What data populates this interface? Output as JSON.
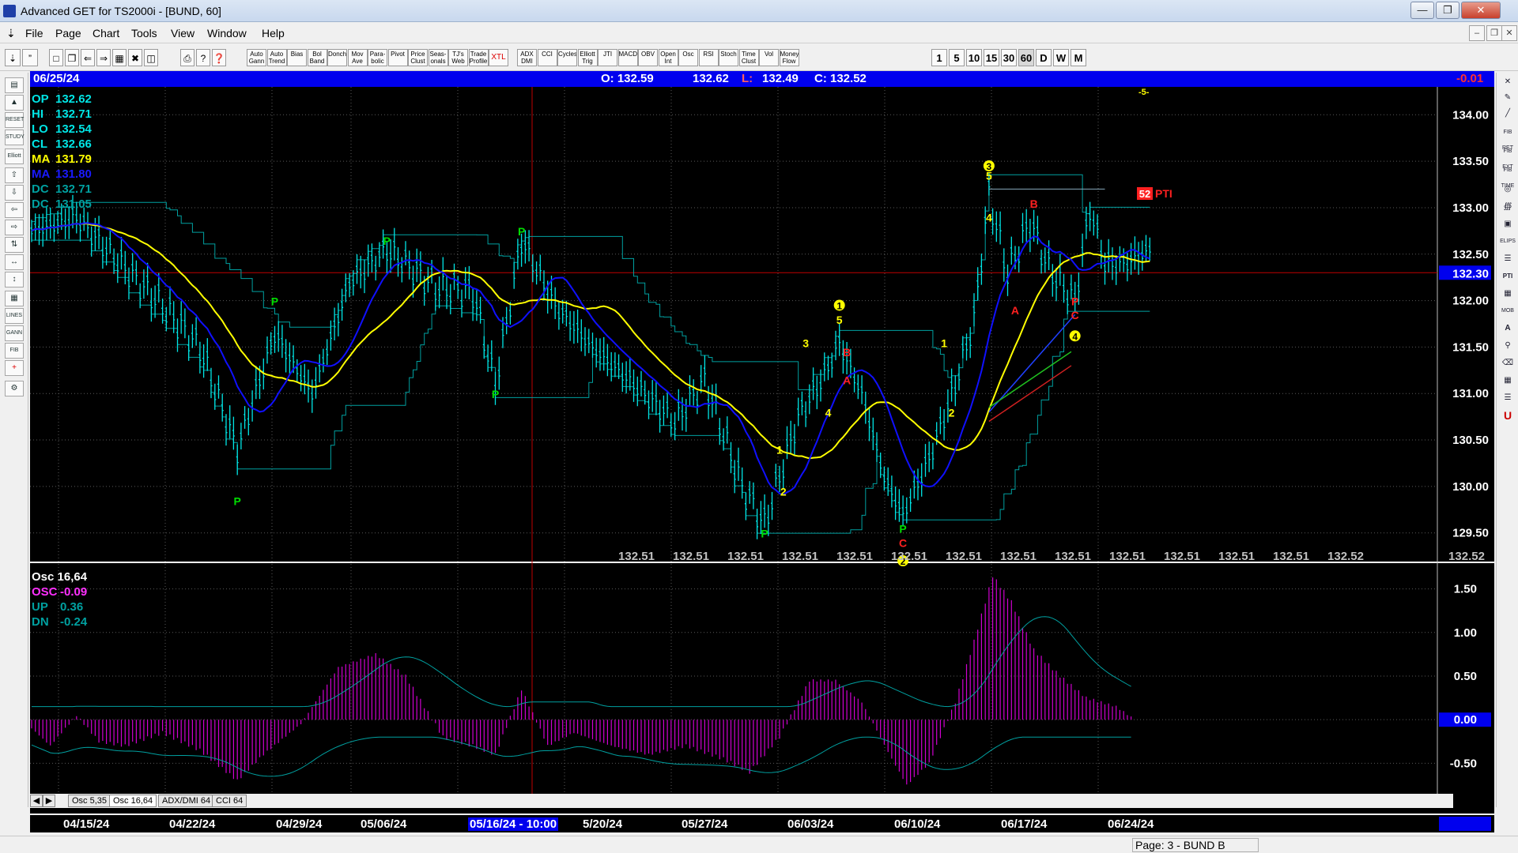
{
  "window": {
    "title": "Advanced GET for TS2000i - [BUND, 60]"
  },
  "menu": [
    "File",
    "Page",
    "Chart",
    "Tools",
    "View",
    "Window",
    "Help"
  ],
  "toolbar": {
    "study_buttons": [
      "Auto Gann",
      "Auto Trend",
      "Bias",
      "Bol Band",
      "Donch",
      "Mov Ave",
      "Para-bolic",
      "Pivot",
      "Price Clust",
      "Seas-onals",
      "TJ's Web",
      "Trade Profile",
      "XTL",
      "ADX DMI",
      "CCI",
      "Cycles",
      "Elliott Trig",
      "JTI",
      "MACD",
      "OBV",
      "Open Int",
      "Osc",
      "RSI",
      "Stoch",
      "Time Clust",
      "Vol",
      "Money Flow"
    ],
    "periods": [
      "1",
      "5",
      "10",
      "15",
      "30",
      "60",
      "D",
      "W",
      "M"
    ],
    "active_period": "60"
  },
  "infobar": {
    "date": "06/25/24",
    "open": "O: 132.59",
    "high": "132.62",
    "low_label": "L:",
    "low": "132.49",
    "close": "C: 132.52",
    "change": "-0.01"
  },
  "colors": {
    "price": "#00e5e5",
    "ma_yellow": "#ffff00",
    "ma_blue": "#1010ff",
    "channel": "#00a0a0",
    "osc": "#d000d0",
    "grid": "#5a5a5a",
    "marker_green": "#00dd00",
    "marker_red": "#ff2020",
    "wave_yellow": "#ffff00"
  },
  "legend_main": [
    {
      "label": "OP",
      "value": "132.62",
      "color": "#00e5e5"
    },
    {
      "label": "HI",
      "value": "132.71",
      "color": "#00e5e5"
    },
    {
      "label": "LO",
      "value": "132.54",
      "color": "#00e5e5"
    },
    {
      "label": "CL",
      "value": "132.66",
      "color": "#00e5e5"
    },
    {
      "label": "MA",
      "value": "131.79",
      "color": "#ffff00"
    },
    {
      "label": "MA",
      "value": "131.80",
      "color": "#1a1aff"
    },
    {
      "label": "DC",
      "value": "132.71",
      "color": "#00a0a0"
    },
    {
      "label": "DC",
      "value": "131.05",
      "color": "#00a0a0"
    }
  ],
  "legend_osc": [
    {
      "label": "Osc 16,64",
      "value": "",
      "color": "#ffffff"
    },
    {
      "label": "OSC",
      "value": "-0.09",
      "color": "#ff30ff"
    },
    {
      "label": "UP",
      "value": "0.36",
      "color": "#00a0a0"
    },
    {
      "label": "DN",
      "value": "-0.24",
      "color": "#00a0a0"
    }
  ],
  "price_axis": {
    "ticks": [
      "134.00",
      "133.50",
      "133.00",
      "132.50",
      "132.00",
      "131.50",
      "131.00",
      "130.50",
      "130.00",
      "129.50"
    ],
    "current": "132.30",
    "range": [
      129.2,
      134.3
    ]
  },
  "osc_axis": {
    "ticks": [
      "1.50",
      "1.00",
      "0.50",
      "0.00",
      "-0.50"
    ],
    "range": [
      -0.85,
      1.75
    ]
  },
  "pti": {
    "value": "52",
    "label": "PTI"
  },
  "top_marker": "-5-",
  "projection_row": [
    "132.51",
    "132.51",
    "132.51",
    "132.51",
    "132.51",
    "132.51",
    "132.51",
    "132.51",
    "132.51",
    "132.51",
    "132.51",
    "132.51",
    "132.51",
    "132.52",
    "132.52"
  ],
  "markers": [
    {
      "text": "P",
      "i": 55,
      "y": 129.8,
      "color": "#00dd00"
    },
    {
      "text": "P",
      "i": 65,
      "y": 131.95,
      "color": "#00dd00"
    },
    {
      "text": "P",
      "i": 95,
      "y": 132.6,
      "color": "#00dd00"
    },
    {
      "text": "P",
      "i": 124,
      "y": 130.95,
      "color": "#00dd00"
    },
    {
      "text": "P",
      "i": 131,
      "y": 132.7,
      "color": "#00dd00"
    },
    {
      "text": "P",
      "i": 196,
      "y": 129.45,
      "color": "#00dd00"
    },
    {
      "text": "P",
      "i": 233,
      "y": 129.5,
      "color": "#00dd00"
    },
    {
      "text": "C",
      "i": 233,
      "y": 129.35,
      "color": "#ff2020"
    },
    {
      "text": "A",
      "i": 218,
      "y": 131.1,
      "color": "#ff2020"
    },
    {
      "text": "B",
      "i": 218,
      "y": 131.4,
      "color": "#ff2020"
    },
    {
      "text": "A",
      "i": 263,
      "y": 131.85,
      "color": "#ff2020"
    },
    {
      "text": "B",
      "i": 268,
      "y": 133.0,
      "color": "#ff2020"
    },
    {
      "text": "P",
      "i": 279,
      "y": 131.95,
      "color": "#ff2020"
    },
    {
      "text": "C",
      "i": 279,
      "y": 131.8,
      "color": "#ff2020"
    },
    {
      "text": "1",
      "i": 200,
      "y": 130.35,
      "color": "#ffff00"
    },
    {
      "text": "2",
      "i": 201,
      "y": 129.9,
      "color": "#ffff00"
    },
    {
      "text": "3",
      "i": 207,
      "y": 131.5,
      "color": "#ffff00"
    },
    {
      "text": "4",
      "i": 213,
      "y": 130.75,
      "color": "#ffff00"
    },
    {
      "text": "5",
      "i": 216,
      "y": 131.75,
      "color": "#ffff00"
    },
    {
      "text": "1",
      "i": 244,
      "y": 131.5,
      "color": "#ffff00"
    },
    {
      "text": "2",
      "i": 246,
      "y": 130.75,
      "color": "#ffff00"
    },
    {
      "text": "4",
      "i": 256,
      "y": 132.85,
      "color": "#ffff00"
    },
    {
      "text": "5",
      "i": 256,
      "y": 133.3,
      "color": "#ffff00"
    }
  ],
  "circled_markers": [
    {
      "text": "1",
      "i": 216,
      "y": 131.95
    },
    {
      "text": "2",
      "i": 233,
      "y": 129.2
    },
    {
      "text": "3",
      "i": 256,
      "y": 133.45
    },
    {
      "text": "4",
      "i": 279,
      "y": 131.62
    }
  ],
  "bottom_tabs": [
    "Osc 5,35",
    "Osc 16,64",
    "ADX/DMI 64",
    "CCI 64"
  ],
  "active_tab": "Osc 16,64",
  "date_labels": [
    "04/15/24",
    "04/22/24",
    "04/29/24",
    "05/06/24",
    "05/16/24 - 10:00",
    "5/20/24",
    "05/27/24",
    "06/03/24",
    "06/10/24",
    "06/17/24",
    "06/24/24"
  ],
  "status": "Page: 3 - BUND B"
}
